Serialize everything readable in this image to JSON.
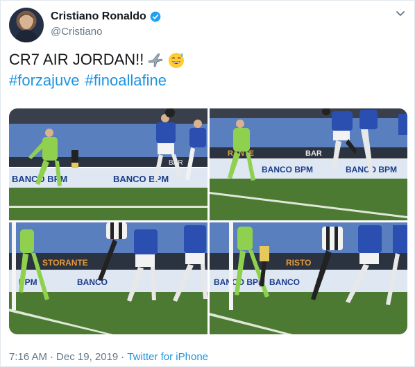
{
  "user": {
    "name": "Cristiano Ronaldo",
    "handle": "@Cristiano",
    "verified": true
  },
  "tweet": {
    "text": "CR7 AIR JORDAN!!",
    "emojis": [
      "airplane-emoji",
      "grinning-sweat-emoji"
    ],
    "hashtags": [
      "#forzajuve",
      "#finoallafine"
    ]
  },
  "media": {
    "photos": [
      {
        "banner_left": "BANCO BPM",
        "banner_right": "BANCO BPM",
        "ad_top_left": "",
        "ad_top_right": "BAR"
      },
      {
        "banner_left": "BANCO BPM",
        "banner_right": "BANCO BPM",
        "ad_top_left": "RANTE",
        "ad_top_right": "BAR"
      },
      {
        "banner_left": "BPM",
        "banner_right": "BANCO",
        "ad_top_left": "STORANTE",
        "ad_top_right": ""
      },
      {
        "banner_left": "BANCO BPM",
        "banner_right": "BANCO",
        "ad_top_left": "",
        "ad_top_right": "RISTO"
      }
    ]
  },
  "footer": {
    "time": "7:16 AM",
    "separator": "·",
    "date": "Dec 19, 2019",
    "source": "Twitter for iPhone"
  },
  "colors": {
    "link": "#1b95e0",
    "sampdoria_blue": "#2a4fb0",
    "keeper_green": "#8fd14f",
    "pitch": "#4c7a32"
  }
}
